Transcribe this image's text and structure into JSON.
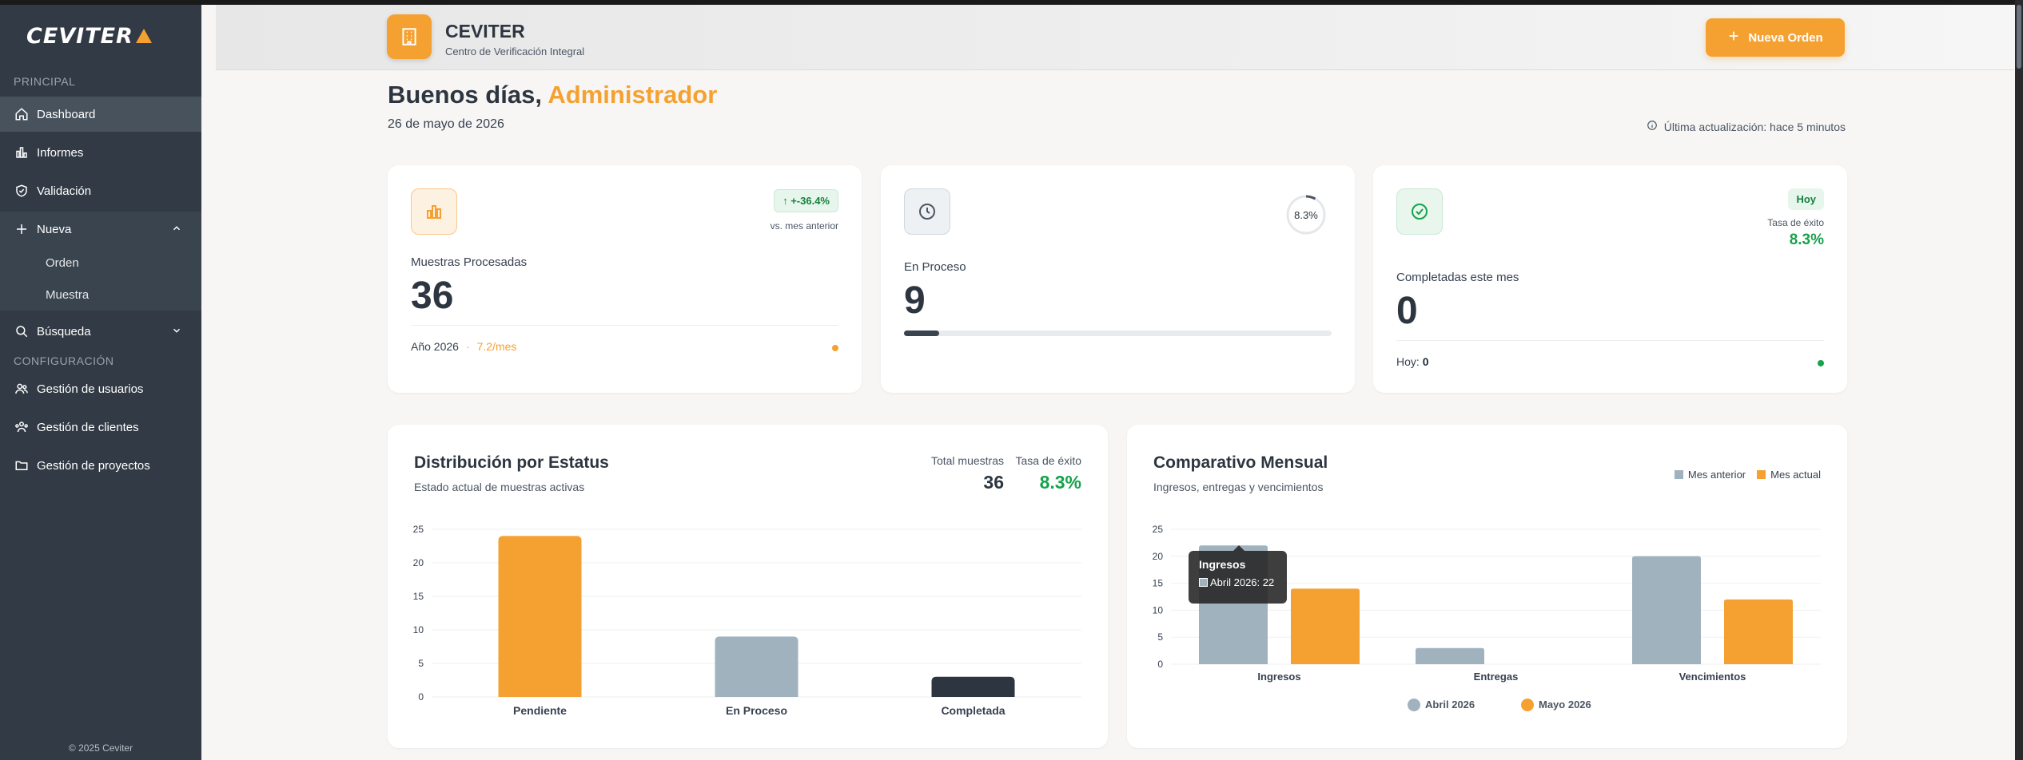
{
  "sidebar": {
    "logo": "CEVITER",
    "section_principal": "PRINCIPAL",
    "section_config": "CONFIGURACIÓN",
    "items": {
      "dashboard": "Dashboard",
      "informes": "Informes",
      "validacion": "Validación",
      "nueva": "Nueva",
      "orden": "Orden",
      "muestra": "Muestra",
      "busqueda": "Búsqueda",
      "usuarios": "Gestión de usuarios",
      "clientes": "Gestión de clientes",
      "proyectos": "Gestión de proyectos"
    },
    "copyright": "© 2025 Ceviter"
  },
  "header": {
    "brand_name": "CEVITER",
    "brand_sub": "Centro de Verificación Integral",
    "new_order_label": "Nueva Orden"
  },
  "greeting": {
    "prefix": "Buenos días,",
    "name": "Administrador",
    "date": "26 de mayo de 2026",
    "updated": "Última actualización: hace 5 minutos"
  },
  "cards": {
    "processed": {
      "label": "Muestras Procesadas",
      "value": "36",
      "trend": "+-36.4%",
      "trend_sub": "vs. mes anterior",
      "foot_year": "Año 2026",
      "foot_sep": "·",
      "foot_rate": "7.2/mes"
    },
    "in_process": {
      "label": "En Proceso",
      "value": "9",
      "ring_label": "8.3%",
      "progress": 0.083
    },
    "completed": {
      "label": "Completadas este mes",
      "value": "0",
      "badge": "Hoy",
      "rate_label": "Tasa de éxito",
      "rate_value": "8.3%",
      "foot_label": "Hoy:",
      "foot_value": "0"
    }
  },
  "status_panel": {
    "title": "Distribución por Estatus",
    "subtitle": "Estado actual de muestras activas",
    "total_label": "Total muestras",
    "total_value": "36",
    "rate_label": "Tasa de éxito",
    "rate_value": "8.3%"
  },
  "monthly_panel": {
    "title": "Comparativo Mensual",
    "subtitle": "Ingresos, entregas y vencimientos",
    "legend_prev": "Mes anterior",
    "legend_curr": "Mes actual",
    "tooltip_title": "Ingresos",
    "tooltip_value": "Abril 2026: 22"
  },
  "colors": {
    "accent": "#f5a131",
    "slate": "#a1b2bf",
    "dark": "#2d3640",
    "green": "#16a34a"
  },
  "chart_data": [
    {
      "type": "bar",
      "categories": [
        "Pendiente",
        "En Proceso",
        "Completada"
      ],
      "values": [
        24,
        9,
        3
      ],
      "colors": [
        "#f5a131",
        "#a1b2bf",
        "#2d3640"
      ],
      "ylim": [
        0,
        25
      ],
      "yticks": [
        0,
        5,
        10,
        15,
        20,
        25
      ]
    },
    {
      "type": "bar",
      "categories": [
        "Ingresos",
        "Entregas",
        "Vencimientos"
      ],
      "series": [
        {
          "name": "Abril 2026",
          "values": [
            22,
            3,
            20
          ],
          "color": "#a1b2bf"
        },
        {
          "name": "Mayo 2026",
          "values": [
            14,
            0,
            12
          ],
          "color": "#f5a131"
        }
      ],
      "ylim": [
        0,
        25
      ],
      "yticks": [
        0,
        5,
        10,
        15,
        20,
        25
      ],
      "legend": "bottom"
    }
  ]
}
